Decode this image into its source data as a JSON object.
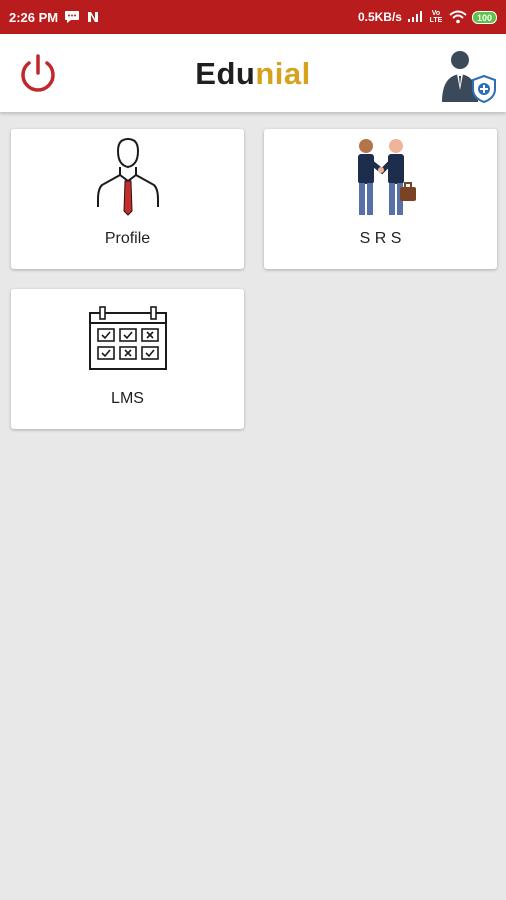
{
  "status_bar": {
    "time": "2:26 PM",
    "network_speed": "0.5KB/s",
    "carrier_label": "Vo LTE",
    "battery_level": "100",
    "icons": [
      "chat-icon",
      "n-app-icon",
      "signal-icon",
      "volte-icon",
      "wifi-icon",
      "battery-icon"
    ]
  },
  "app_bar": {
    "brand_part1": "Edu",
    "brand_part2": "nial",
    "colors": {
      "brand_dark": "#1f1f1f",
      "brand_accent": "#d6a21c",
      "power": "#c0282d"
    },
    "icons": [
      "power-icon",
      "admin-shield-icon"
    ]
  },
  "tiles": [
    {
      "label": "Profile",
      "icon": "person-tie-icon"
    },
    {
      "label": "S R S",
      "icon": "handshake-icon"
    },
    {
      "label": "LMS",
      "icon": "calendar-icon"
    }
  ],
  "colors": {
    "status_bar": "#b81c1c",
    "background": "#e8e8e8",
    "card": "#ffffff"
  }
}
